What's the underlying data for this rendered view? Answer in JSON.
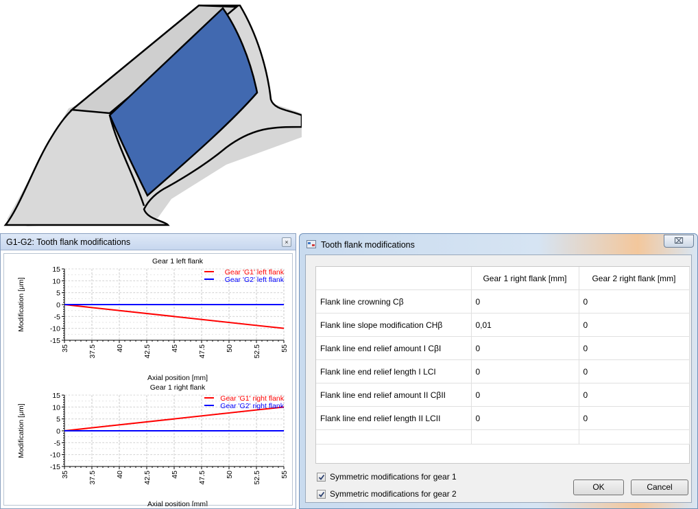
{
  "chart_window": {
    "title": "G1-G2: Tooth flank modifications",
    "close_glyph": "×"
  },
  "chart_data": [
    {
      "type": "line",
      "title": "Gear 1 left flank",
      "xlabel": "Axial position [mm]",
      "ylabel": "Modification [μm]",
      "xlim": [
        35,
        55
      ],
      "ylim": [
        -15,
        15
      ],
      "x_ticks": [
        "35",
        "37.5",
        "40",
        "42.5",
        "45",
        "47.5",
        "50",
        "52.5",
        "55"
      ],
      "y_ticks": [
        "15",
        "10",
        "5",
        "0",
        "-5",
        "-10",
        "-15"
      ],
      "grid": true,
      "legend": "top-right",
      "series": [
        {
          "name": "Gear 'G1' left flank",
          "color": "#ff0000",
          "x": [
            35,
            55
          ],
          "y": [
            0,
            -10
          ]
        },
        {
          "name": "Gear 'G2' left flank",
          "color": "#0000ff",
          "x": [
            35,
            55
          ],
          "y": [
            0,
            0
          ]
        }
      ]
    },
    {
      "type": "line",
      "title": "Gear 1 right flank",
      "xlabel": "Axial position [mm]",
      "ylabel": "Modification [μm]",
      "xlim": [
        35,
        55
      ],
      "ylim": [
        -15,
        15
      ],
      "x_ticks": [
        "35",
        "37.5",
        "40",
        "42.5",
        "45",
        "47.5",
        "50",
        "52.5",
        "55"
      ],
      "y_ticks": [
        "15",
        "10",
        "5",
        "0",
        "-5",
        "-10",
        "-15"
      ],
      "grid": true,
      "legend": "top-right",
      "series": [
        {
          "name": "Gear 'G1' right flank",
          "color": "#ff0000",
          "x": [
            35,
            55
          ],
          "y": [
            0,
            10
          ]
        },
        {
          "name": "Gear 'G2' right flank",
          "color": "#0000ff",
          "x": [
            35,
            55
          ],
          "y": [
            0,
            0
          ]
        }
      ]
    }
  ],
  "dialog": {
    "title": "Tooth flank modifications",
    "close_glyph": "⌧",
    "table": {
      "headers": [
        "",
        "Gear 1 right flank [mm]",
        "Gear 2 right flank [mm]"
      ],
      "rows": [
        {
          "label": "Flank line crowning Cβ",
          "g1": "0",
          "g2": "0"
        },
        {
          "label": "Flank line slope modification CHβ",
          "g1": "0,01",
          "g2": "0"
        },
        {
          "label": "Flank line end relief amount I CβI",
          "g1": "0",
          "g2": "0"
        },
        {
          "label": "Flank line end relief length I LCI",
          "g1": "0",
          "g2": "0"
        },
        {
          "label": "Flank line end relief amount II CβII",
          "g1": "0",
          "g2": "0"
        },
        {
          "label": "Flank line end relief length II LCII",
          "g1": "0",
          "g2": "0"
        }
      ]
    },
    "checkboxes": [
      {
        "label": "Symmetric modifications for gear 1",
        "checked": true
      },
      {
        "label": "Symmetric modifications for gear 2",
        "checked": true
      }
    ],
    "ok_label": "OK",
    "cancel_label": "Cancel"
  },
  "colors": {
    "flank_fill": "#4169b0",
    "tooth_fill": "#d9d9d9",
    "series_red": "#ff0000",
    "series_blue": "#0000ff"
  }
}
